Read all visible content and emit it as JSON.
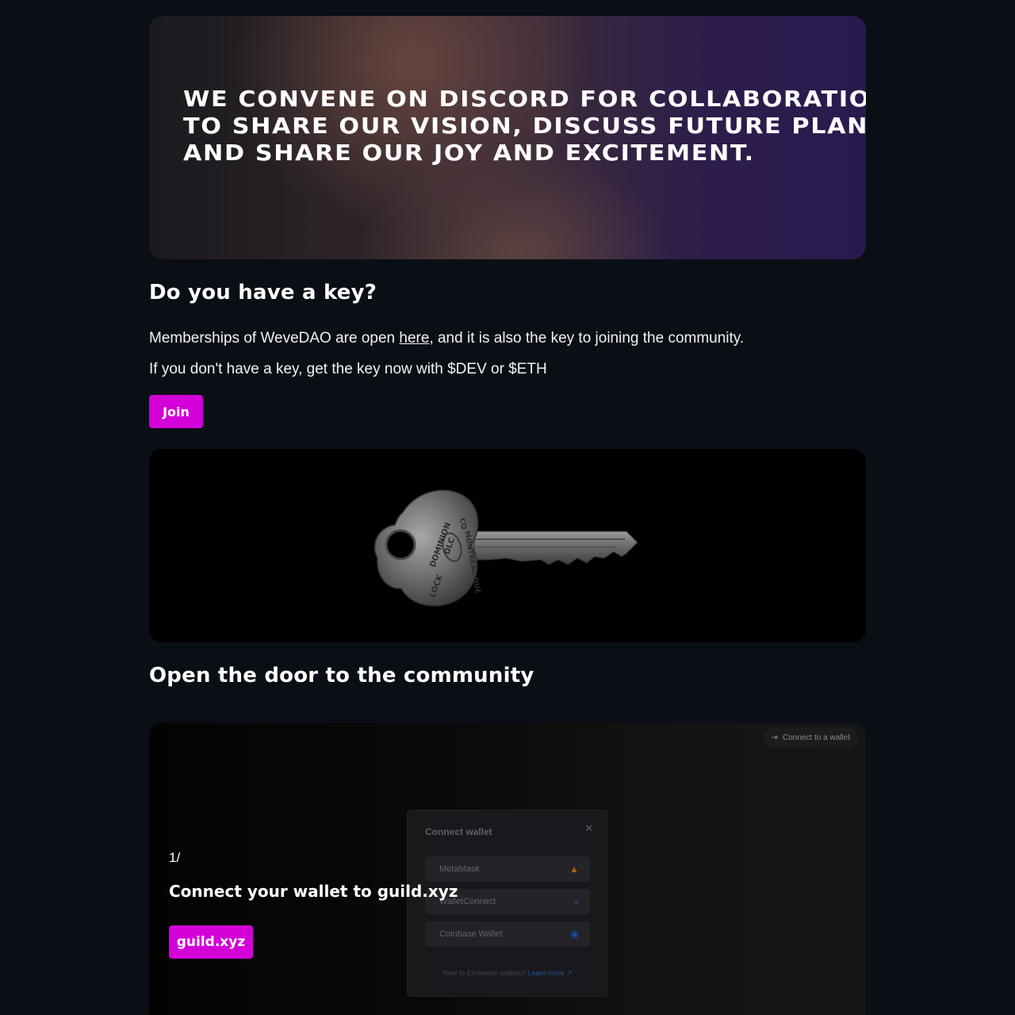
{
  "hero": {
    "text": "We convene on Discord for collaboration, to share our vision, discuss future plans, and share our joy and excitement."
  },
  "key_section": {
    "heading": "Do you have a key?",
    "line1_before": "Memberships of WeveDAO are open ",
    "line1_link": "here",
    "line1_after": ", and it is also the key to joining the community.",
    "line2": "If you don't have a key, get the key now with $DEV or $ETH",
    "join_label": "Join"
  },
  "key_image": {
    "engraving_top": "DOMINION",
    "engraving_mid": "LOCK",
    "engraving_brand": "DLC",
    "engraving_co": "CO",
    "engraving_city": "MONTREAL QUE"
  },
  "community_section": {
    "heading": "Open the door to the community"
  },
  "guild_card": {
    "connect_pill": "Connect to a wallet",
    "modal_title": "Connect wallet",
    "wallets": [
      {
        "label": "MetaMask",
        "icon": "metamask-fox-icon"
      },
      {
        "label": "WalletConnect",
        "icon": "walletconnect-icon"
      },
      {
        "label": "Coinbase Wallet",
        "icon": "coinbase-icon"
      }
    ],
    "foot_text": "New to Ethereum wallets?",
    "foot_link": "Learn more",
    "step": "1/",
    "step_title": "Connect your wallet to guild.xyz",
    "button_label": "guild.xyz"
  },
  "colors": {
    "accent": "#d400d8",
    "background": "#0a0f16"
  }
}
